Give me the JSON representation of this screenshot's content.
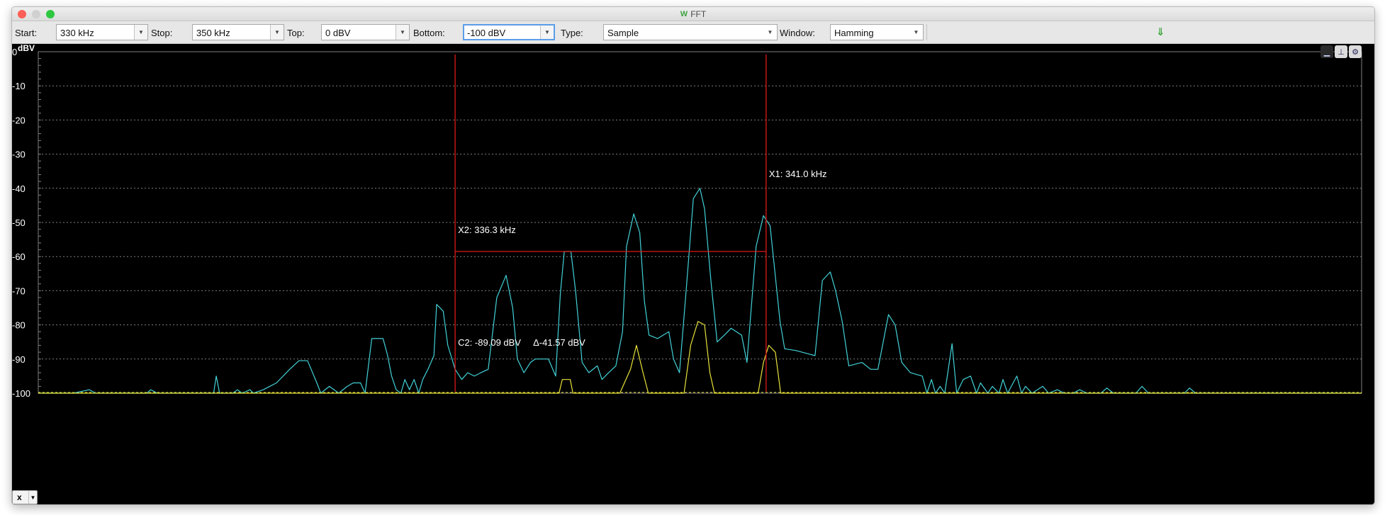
{
  "window": {
    "title": "FFT",
    "controls": {
      "close_color": "#fd5f57",
      "minimize_color": "#d0d0d0",
      "zoom_color": "#2dc840"
    }
  },
  "toolbar": {
    "start": {
      "label": "Start:",
      "value": "330 kHz"
    },
    "stop": {
      "label": "Stop:",
      "value": "350 kHz"
    },
    "top": {
      "label": "Top:",
      "value": "0 dBV"
    },
    "bottom": {
      "label": "Bottom:",
      "value": "-100 dBV"
    },
    "type": {
      "label": "Type:",
      "value": "Sample"
    },
    "window_fn": {
      "label": "Window:",
      "value": "Hamming"
    },
    "dropdown_glyph": "▼",
    "download_icon": "⇓"
  },
  "plot_tools": [
    {
      "name": "bottom-axis-icon",
      "glyph": "▁"
    },
    {
      "name": "axes-icon",
      "glyph": "⊥"
    },
    {
      "name": "settings-gear-icon",
      "glyph": "⚙"
    }
  ],
  "axis_selector": {
    "value": "x",
    "arrow": "▼"
  },
  "colors": {
    "background": "#000000",
    "grid": "#7f7f7f",
    "trace_main": "#42d2d8",
    "trace_second": "#e9e23a",
    "cursor": "#e01818",
    "text": "#ffffff"
  },
  "chart_data": {
    "type": "line",
    "ylabel": "dBV",
    "xlim": [
      330,
      350
    ],
    "ylim": [
      -100,
      0
    ],
    "y_ticks": [
      0,
      -10,
      -20,
      -30,
      -40,
      -50,
      -60,
      -70,
      -80,
      -90,
      -100
    ],
    "grid": true,
    "series": [
      {
        "color": "#42d2d8",
        "points": [
          [
            330.0,
            -100
          ],
          [
            330.53,
            -100
          ],
          [
            330.77,
            -99
          ],
          [
            330.87,
            -100
          ],
          [
            331.1,
            -100
          ],
          [
            331.44,
            -100
          ],
          [
            331.64,
            -100
          ],
          [
            331.7,
            -99
          ],
          [
            331.8,
            -100
          ],
          [
            332.17,
            -100
          ],
          [
            332.5,
            -100
          ],
          [
            332.65,
            -100
          ],
          [
            332.69,
            -95
          ],
          [
            332.74,
            -100
          ],
          [
            332.94,
            -100
          ],
          [
            333.01,
            -99
          ],
          [
            333.08,
            -100
          ],
          [
            333.2,
            -99
          ],
          [
            333.25,
            -100
          ],
          [
            333.4,
            -99
          ],
          [
            333.6,
            -97
          ],
          [
            333.8,
            -93
          ],
          [
            333.94,
            -90.5
          ],
          [
            334.07,
            -90.5
          ],
          [
            334.21,
            -97
          ],
          [
            334.27,
            -100
          ],
          [
            334.4,
            -98
          ],
          [
            334.54,
            -100
          ],
          [
            334.67,
            -98
          ],
          [
            334.76,
            -97
          ],
          [
            334.87,
            -97
          ],
          [
            334.94,
            -100
          ],
          [
            335.04,
            -84
          ],
          [
            335.21,
            -84
          ],
          [
            335.28,
            -89
          ],
          [
            335.34,
            -95
          ],
          [
            335.41,
            -99
          ],
          [
            335.48,
            -100
          ],
          [
            335.54,
            -96
          ],
          [
            335.61,
            -99
          ],
          [
            335.68,
            -96
          ],
          [
            335.75,
            -100
          ],
          [
            335.81,
            -96
          ],
          [
            335.89,
            -93
          ],
          [
            335.98,
            -89
          ],
          [
            336.02,
            -74
          ],
          [
            336.12,
            -76
          ],
          [
            336.19,
            -86
          ],
          [
            336.3,
            -93
          ],
          [
            336.4,
            -96
          ],
          [
            336.49,
            -94
          ],
          [
            336.59,
            -95
          ],
          [
            336.69,
            -94
          ],
          [
            336.8,
            -93
          ],
          [
            336.93,
            -72
          ],
          [
            337.07,
            -65.5
          ],
          [
            337.17,
            -75
          ],
          [
            337.24,
            -90
          ],
          [
            337.34,
            -94
          ],
          [
            337.44,
            -91
          ],
          [
            337.51,
            -90
          ],
          [
            337.71,
            -90
          ],
          [
            337.82,
            -95
          ],
          [
            337.89,
            -71
          ],
          [
            337.95,
            -58.5
          ],
          [
            338.05,
            -58.5
          ],
          [
            338.12,
            -70
          ],
          [
            338.22,
            -91
          ],
          [
            338.32,
            -94
          ],
          [
            338.45,
            -92
          ],
          [
            338.52,
            -96
          ],
          [
            338.62,
            -94
          ],
          [
            338.73,
            -92
          ],
          [
            338.83,
            -82
          ],
          [
            338.89,
            -57
          ],
          [
            339.0,
            -47.5
          ],
          [
            339.09,
            -53
          ],
          [
            339.16,
            -73
          ],
          [
            339.23,
            -83
          ],
          [
            339.36,
            -84
          ],
          [
            339.53,
            -82
          ],
          [
            339.6,
            -90
          ],
          [
            339.69,
            -94
          ],
          [
            339.8,
            -68
          ],
          [
            339.9,
            -43
          ],
          [
            340.0,
            -40
          ],
          [
            340.07,
            -46
          ],
          [
            340.17,
            -68
          ],
          [
            340.26,
            -85
          ],
          [
            340.37,
            -83
          ],
          [
            340.47,
            -81
          ],
          [
            340.63,
            -83
          ],
          [
            340.71,
            -91
          ],
          [
            340.85,
            -57
          ],
          [
            340.96,
            -48
          ],
          [
            341.06,
            -51
          ],
          [
            341.13,
            -64
          ],
          [
            341.21,
            -79
          ],
          [
            341.28,
            -87
          ],
          [
            341.45,
            -87.5
          ],
          [
            341.64,
            -88.5
          ],
          [
            341.74,
            -89
          ],
          [
            341.85,
            -67
          ],
          [
            341.97,
            -64.5
          ],
          [
            342.05,
            -70
          ],
          [
            342.15,
            -79
          ],
          [
            342.25,
            -92
          ],
          [
            342.45,
            -91
          ],
          [
            342.58,
            -93
          ],
          [
            342.69,
            -93
          ],
          [
            342.85,
            -77
          ],
          [
            342.95,
            -80
          ],
          [
            343.05,
            -91
          ],
          [
            343.18,
            -94
          ],
          [
            343.36,
            -95
          ],
          [
            343.43,
            -100
          ],
          [
            343.5,
            -96
          ],
          [
            343.56,
            -100
          ],
          [
            343.63,
            -98
          ],
          [
            343.7,
            -100
          ],
          [
            343.81,
            -85.5
          ],
          [
            343.88,
            -100
          ],
          [
            343.98,
            -96
          ],
          [
            344.09,
            -95
          ],
          [
            344.18,
            -100
          ],
          [
            344.24,
            -97
          ],
          [
            344.35,
            -100
          ],
          [
            344.42,
            -98
          ],
          [
            344.52,
            -100
          ],
          [
            344.58,
            -96
          ],
          [
            344.65,
            -100
          ],
          [
            344.79,
            -95
          ],
          [
            344.86,
            -100
          ],
          [
            344.92,
            -98
          ],
          [
            345.02,
            -100
          ],
          [
            345.18,
            -98
          ],
          [
            345.27,
            -100
          ],
          [
            345.4,
            -99
          ],
          [
            345.51,
            -100
          ],
          [
            345.64,
            -100
          ],
          [
            345.74,
            -99
          ],
          [
            345.85,
            -100
          ],
          [
            346.06,
            -100
          ],
          [
            346.15,
            -98.5
          ],
          [
            346.25,
            -100
          ],
          [
            346.59,
            -100
          ],
          [
            346.68,
            -98
          ],
          [
            346.78,
            -100
          ],
          [
            347.1,
            -100
          ],
          [
            347.32,
            -100
          ],
          [
            347.4,
            -98.5
          ],
          [
            347.49,
            -100
          ],
          [
            347.8,
            -100
          ],
          [
            348.1,
            -100
          ],
          [
            348.57,
            -100
          ],
          [
            348.88,
            -100
          ],
          [
            349.17,
            -100
          ],
          [
            349.6,
            -100
          ],
          [
            350.0,
            -100
          ]
        ]
      },
      {
        "color": "#e9e23a",
        "points": [
          [
            330.0,
            -100
          ],
          [
            337.87,
            -100
          ],
          [
            337.92,
            -96
          ],
          [
            338.04,
            -96
          ],
          [
            338.08,
            -100
          ],
          [
            338.79,
            -100
          ],
          [
            338.95,
            -93
          ],
          [
            339.04,
            -86
          ],
          [
            339.14,
            -94
          ],
          [
            339.22,
            -100
          ],
          [
            339.76,
            -100
          ],
          [
            339.86,
            -86
          ],
          [
            339.97,
            -79
          ],
          [
            340.07,
            -80
          ],
          [
            340.15,
            -94
          ],
          [
            340.22,
            -100
          ],
          [
            340.88,
            -100
          ],
          [
            340.96,
            -91
          ],
          [
            341.04,
            -86
          ],
          [
            341.14,
            -88
          ],
          [
            341.22,
            -100
          ],
          [
            350.0,
            -100
          ]
        ]
      }
    ],
    "cursors": [
      {
        "label": "X1: 341.0 kHz",
        "x": 341.0
      },
      {
        "label": "X2: 336.3 kHz",
        "x": 336.3
      }
    ],
    "level_line": {
      "y": -58.5,
      "from_x": 336.3,
      "to_x": 341.0
    },
    "baseline_dashed_y": -100,
    "annotations": [
      "C2: -89.09 dBV",
      "Δ-41.57 dBV"
    ]
  }
}
